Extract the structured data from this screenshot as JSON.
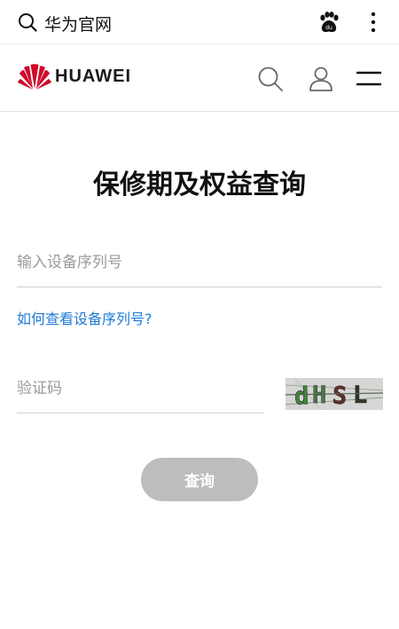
{
  "browser": {
    "title": "华为官网"
  },
  "header": {
    "brand": "HUAWEI",
    "brand_color": "#cf0a2c"
  },
  "main": {
    "title": "保修期及权益查询",
    "serial_placeholder": "输入设备序列号",
    "help_link": "如何查看设备序列号?",
    "captcha_placeholder": "验证码",
    "captcha_text": "dHSL",
    "submit_label": "查询"
  },
  "colors": {
    "link": "#1f7bd6",
    "button_disabled": "#bdbdbd"
  }
}
